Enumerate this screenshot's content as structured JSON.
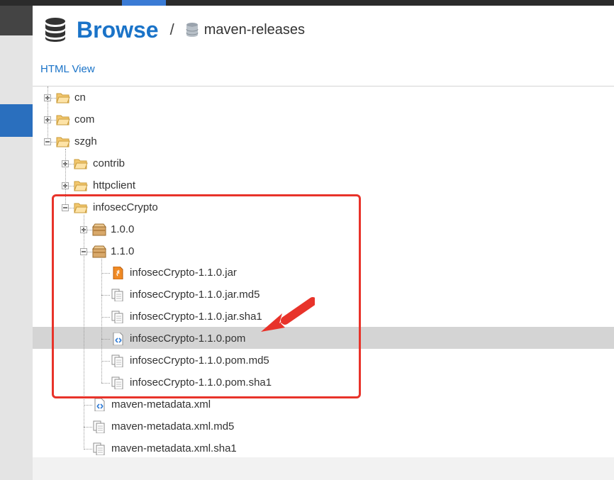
{
  "header": {
    "title": "Browse",
    "separator": "/",
    "repository": "maven-releases"
  },
  "html_view_link": "HTML View",
  "tree": {
    "cn": "cn",
    "com": "com",
    "szgh": "szgh",
    "contrib": "contrib",
    "httpclient": "httpclient",
    "infosecCrypto": "infosecCrypto",
    "v100": "1.0.0",
    "v110": "1.1.0",
    "jar": "infosecCrypto-1.1.0.jar",
    "jar_md5": "infosecCrypto-1.1.0.jar.md5",
    "jar_sha1": "infosecCrypto-1.1.0.jar.sha1",
    "pom": "infosecCrypto-1.1.0.pom",
    "pom_md5": "infosecCrypto-1.1.0.pom.md5",
    "pom_sha1": "infosecCrypto-1.1.0.pom.sha1",
    "meta": "maven-metadata.xml",
    "meta_md5": "maven-metadata.xml.md5",
    "meta_sha1": "maven-metadata.xml.sha1"
  },
  "selected_item": "infosecCrypto-1.1.0.pom",
  "colors": {
    "brand": "#1a73c8",
    "selection": "#d4d4d4",
    "annotation": "#e8332a"
  }
}
